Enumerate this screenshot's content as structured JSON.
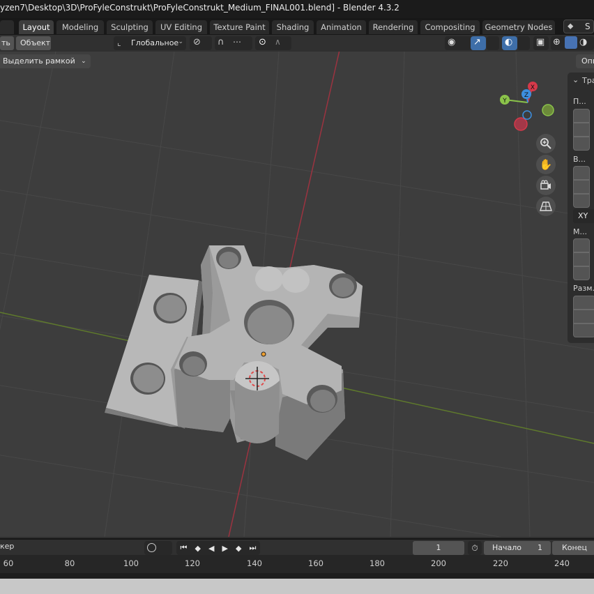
{
  "window": {
    "title": "yzen7\\Desktop\\3D\\ProFyleConstrukt\\ProFyleConstrukt_Medium_FINAL001.blend] - Blender 4.3.2"
  },
  "workspace_tabs": [
    "Layout",
    "Modeling",
    "Sculpting",
    "UV Editing",
    "Texture Paint",
    "Shading",
    "Animation",
    "Rendering",
    "Compositing",
    "Geometry Nodes"
  ],
  "active_tab": "Layout",
  "scene_selector_letter": "S",
  "header": {
    "mode_left": "ть",
    "menu_object": "Объект",
    "orientation": "Глобальное"
  },
  "viewport": {
    "select_tool": "Выделить рамкой",
    "options_label": "Опц",
    "gizmo_axes": {
      "x": "X",
      "y": "Y",
      "z": "Z"
    }
  },
  "n_panel": {
    "section_title": "Тра",
    "location_label": "П...",
    "rotation_label": "В...",
    "rotation_mode": "XY",
    "scale_label": "М...",
    "dimensions_label": "Разм."
  },
  "timeline": {
    "marker_label": "кер",
    "current_frame": "1",
    "start_label": "Начало",
    "start_value": "1",
    "end_label": "Конец",
    "ruler_ticks": [
      "60",
      "80",
      "100",
      "120",
      "140",
      "160",
      "180",
      "200",
      "220",
      "240"
    ]
  },
  "colors": {
    "active_tab_bg": "#3d3d3d",
    "viewport_bg": "#3d3d3d",
    "x_axis": "#d6394a",
    "y_axis": "#8bc34a",
    "z_axis": "#3d8fe0",
    "mesh": "#9a9a9a"
  },
  "icons": [
    "cursor-select-icon",
    "snap-magnet-icon",
    "proportional-edit-icon",
    "visibility-icon",
    "gizmo-icon",
    "overlay-icon",
    "xray-icon",
    "shading-wire-icon",
    "shading-solid-icon",
    "shading-material-icon",
    "zoom-icon",
    "pan-hand-icon",
    "camera-view-icon",
    "perspective-grid-icon",
    "jump-start-icon",
    "prev-keyframe-icon",
    "play-reverse-icon",
    "play-icon",
    "next-keyframe-icon",
    "jump-end-icon",
    "stopwatch-icon",
    "3d-cursor-icon"
  ]
}
